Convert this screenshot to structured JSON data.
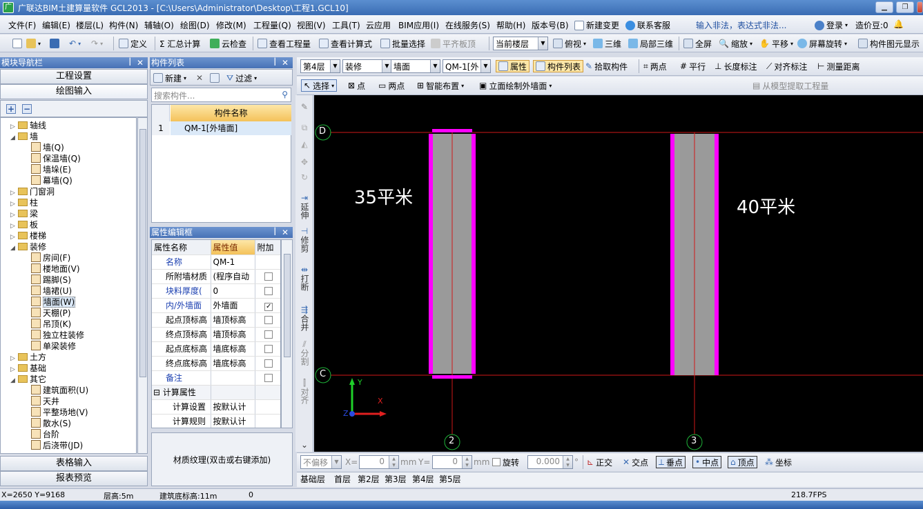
{
  "titlebar": {
    "title": "广联达BIM土建算量软件 GCL2013 - [C:\\Users\\Administrator\\Desktop\\工程1.GCL10]"
  },
  "menu": [
    "文件(F)",
    "编辑(E)",
    "楼层(L)",
    "构件(N)",
    "辅轴(O)",
    "绘图(D)",
    "修改(M)",
    "工程量(Q)",
    "视图(V)",
    "工具(T)",
    "云应用",
    "BIM应用(I)",
    "在线服务(S)",
    "帮助(H)",
    "版本号(B)",
    "新建变更",
    "联系客服"
  ],
  "menu_warning": "输入非法，表达式非法...",
  "account": {
    "login": "登录",
    "price_beans": "造价豆:0"
  },
  "toolbar1": {
    "define": "定义",
    "sum_calc": "Σ 汇总计算",
    "cloud_check": "云检查",
    "view_qty": "查看工程量",
    "view_formula": "查看计算式",
    "batch_select": "批量选择",
    "flush_slab": "平齐板顶",
    "current_floor": "当前楼层",
    "top_view": "俯视",
    "three_d": "三维",
    "local_3d": "局部三维",
    "full_screen": "全屏",
    "zoom": "缩放",
    "pan": "平移",
    "rotate": "屏幕旋转",
    "comp_display": "构件图元显示"
  },
  "toolbar2": {
    "floor": "第4层",
    "category": "装修",
    "type": "墙面",
    "component": "QM-1[外",
    "attr_btn": "属性",
    "comp_list_btn": "构件列表",
    "pick": "拾取构件",
    "two_point": "两点",
    "parallel": "平行",
    "length_mark": "长度标注",
    "align_mark": "对齐标注",
    "measure": "测量距离"
  },
  "toolbar3": {
    "select": "选择",
    "point": "点",
    "two_point": "两点",
    "smart_layout": "智能布置",
    "facade_draw": "立面绘制外墙面",
    "extract": "从模型提取工程量"
  },
  "nav": {
    "title": "模块导航栏",
    "project_settings": "工程设置",
    "drawing_input": "绘图输入",
    "table_input": "表格输入",
    "report_preview": "报表预览"
  },
  "tree": [
    {
      "level": 0,
      "exp": "▷",
      "label": "轴线",
      "kind": "folder"
    },
    {
      "level": 0,
      "exp": "◢",
      "label": "墙",
      "kind": "folder"
    },
    {
      "level": 1,
      "exp": "",
      "label": "墙(Q)",
      "kind": "leaf"
    },
    {
      "level": 1,
      "exp": "",
      "label": "保温墙(Q)",
      "kind": "leaf"
    },
    {
      "level": 1,
      "exp": "",
      "label": "墙垛(E)",
      "kind": "leaf"
    },
    {
      "level": 1,
      "exp": "",
      "label": "幕墙(Q)",
      "kind": "leaf"
    },
    {
      "level": 0,
      "exp": "▷",
      "label": "门窗洞",
      "kind": "folder"
    },
    {
      "level": 0,
      "exp": "▷",
      "label": "柱",
      "kind": "folder"
    },
    {
      "level": 0,
      "exp": "▷",
      "label": "梁",
      "kind": "folder"
    },
    {
      "level": 0,
      "exp": "▷",
      "label": "板",
      "kind": "folder"
    },
    {
      "level": 0,
      "exp": "▷",
      "label": "楼梯",
      "kind": "folder"
    },
    {
      "level": 0,
      "exp": "◢",
      "label": "装修",
      "kind": "folder"
    },
    {
      "level": 1,
      "exp": "",
      "label": "房间(F)",
      "kind": "leaf"
    },
    {
      "level": 1,
      "exp": "",
      "label": "楼地面(V)",
      "kind": "leaf"
    },
    {
      "level": 1,
      "exp": "",
      "label": "踢脚(S)",
      "kind": "leaf"
    },
    {
      "level": 1,
      "exp": "",
      "label": "墙裙(U)",
      "kind": "leaf"
    },
    {
      "level": 1,
      "exp": "",
      "label": "墙面(W)",
      "kind": "leaf"
    },
    {
      "level": 1,
      "exp": "",
      "label": "天棚(P)",
      "kind": "leaf"
    },
    {
      "level": 1,
      "exp": "",
      "label": "吊顶(K)",
      "kind": "leaf"
    },
    {
      "level": 1,
      "exp": "",
      "label": "独立柱装修",
      "kind": "leaf"
    },
    {
      "level": 1,
      "exp": "",
      "label": "单梁装修",
      "kind": "leaf"
    },
    {
      "level": 0,
      "exp": "▷",
      "label": "土方",
      "kind": "folder"
    },
    {
      "level": 0,
      "exp": "▷",
      "label": "基础",
      "kind": "folder"
    },
    {
      "level": 0,
      "exp": "◢",
      "label": "其它",
      "kind": "folder"
    },
    {
      "level": 1,
      "exp": "",
      "label": "建筑面积(U)",
      "kind": "leaf"
    },
    {
      "level": 1,
      "exp": "",
      "label": "天井",
      "kind": "leaf"
    },
    {
      "level": 1,
      "exp": "",
      "label": "平整场地(V)",
      "kind": "leaf"
    },
    {
      "level": 1,
      "exp": "",
      "label": "散水(S)",
      "kind": "leaf"
    },
    {
      "level": 1,
      "exp": "",
      "label": "台阶",
      "kind": "leaf"
    },
    {
      "level": 1,
      "exp": "",
      "label": "后浇带(JD)",
      "kind": "leaf"
    }
  ],
  "comp_list": {
    "title": "构件列表",
    "new_btn": "新建",
    "filter_btn": "过滤",
    "search_placeholder": "搜索构件...",
    "col_name": "构件名称",
    "rows": [
      {
        "num": "1",
        "name": "QM-1[外墙面]"
      }
    ]
  },
  "prop_editor": {
    "title": "属性编辑框",
    "col_name": "属性名称",
    "col_value": "属性值",
    "col_extra": "附加",
    "rows": [
      {
        "name": "名称",
        "value": "QM-1",
        "blue": true,
        "check": null
      },
      {
        "name": "所附墙材质",
        "value": "(程序自动",
        "blue": false,
        "check": false
      },
      {
        "name": "块料厚度(",
        "value": "0",
        "blue": true,
        "check": false
      },
      {
        "name": "内/外墙面",
        "value": "外墙面",
        "blue": true,
        "check": true
      },
      {
        "name": "起点顶标高",
        "value": "墙顶标高",
        "blue": false,
        "check": false
      },
      {
        "name": "终点顶标高",
        "value": "墙顶标高",
        "blue": false,
        "check": false
      },
      {
        "name": "起点底标高",
        "value": "墙底标高",
        "blue": false,
        "check": false
      },
      {
        "name": "终点底标高",
        "value": "墙底标高",
        "blue": false,
        "check": false
      },
      {
        "name": "备注",
        "value": "",
        "blue": true,
        "check": false
      },
      {
        "name": "计算属性",
        "value": "",
        "blue": false,
        "check": null,
        "group": true
      },
      {
        "name": "计算设置",
        "value": "按默认计",
        "blue": false,
        "check": null,
        "indent": true
      },
      {
        "name": "计算规则",
        "value": "按默认计",
        "blue": false,
        "check": null,
        "indent": true
      }
    ],
    "texture": "材质纹理(双击或右键添加)"
  },
  "vtools": [
    "延伸",
    "修剪",
    "打断",
    "合并",
    "分割",
    "对齐"
  ],
  "canvas": {
    "axis_d": "D",
    "axis_c": "C",
    "axis_2": "2",
    "axis_3": "3",
    "label_left": "35平米",
    "label_right": "40平米",
    "y_axis": "Y",
    "x_axis": "X",
    "z_axis": "Z"
  },
  "bottom_tools": {
    "no_offset": "不偏移",
    "x_label": "X=",
    "x_val": "0",
    "mm1": "mm",
    "y_label": "Y=",
    "y_val": "0",
    "mm2": "mm",
    "rotate": "旋转",
    "angle": "0.000",
    "deg": "°",
    "ortho": "正交",
    "intersect": "交点",
    "vertical": "垂点",
    "mid": "中点",
    "vertex": "顶点",
    "coord": "坐标"
  },
  "layers": [
    "基础层",
    "首层",
    "第2层",
    "第3层",
    "第4层",
    "第5层"
  ],
  "status": {
    "xy": "X=2650  Y=9168",
    "floor_height": "层高:5m",
    "base_elev": "建筑底标高:11m",
    "zero": "0",
    "fps": "218.7FPS"
  }
}
